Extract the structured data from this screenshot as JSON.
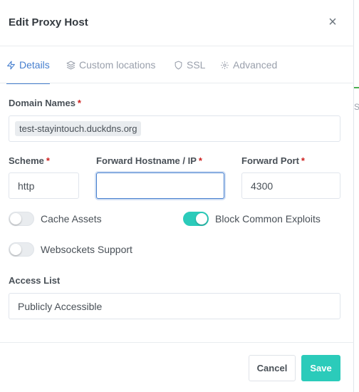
{
  "modal": {
    "title": "Edit Proxy Host",
    "close_label": "×"
  },
  "tabs": [
    {
      "label": "Details",
      "icon": "zap-icon",
      "active": true
    },
    {
      "label": "Custom locations",
      "icon": "layers-icon",
      "active": false
    },
    {
      "label": "SSL",
      "icon": "shield-icon",
      "active": false
    },
    {
      "label": "Advanced",
      "icon": "gear-icon",
      "active": false
    }
  ],
  "form": {
    "domain_names": {
      "label": "Domain Names",
      "required_mark": "*",
      "chips": [
        "test-stayintouch.duckdns.org"
      ]
    },
    "scheme": {
      "label": "Scheme",
      "required_mark": "*",
      "value": "http"
    },
    "forward_hostname": {
      "label": "Forward Hostname / IP",
      "required_mark": "*",
      "value": ""
    },
    "forward_port": {
      "label": "Forward Port",
      "required_mark": "*",
      "value": "4300"
    },
    "cache_assets": {
      "label": "Cache Assets",
      "enabled": false
    },
    "block_common_exploits": {
      "label": "Block Common Exploits",
      "enabled": true
    },
    "websockets_support": {
      "label": "Websockets Support",
      "enabled": false
    },
    "access_list": {
      "label": "Access List",
      "value": "Publicly Accessible"
    }
  },
  "footer": {
    "cancel_label": "Cancel",
    "save_label": "Save"
  },
  "background": {
    "partial_letter": "S"
  },
  "colors": {
    "accent": "#467fcf",
    "teal": "#2bcbba",
    "required": "#cd201f",
    "background_green": "#4caf50"
  }
}
